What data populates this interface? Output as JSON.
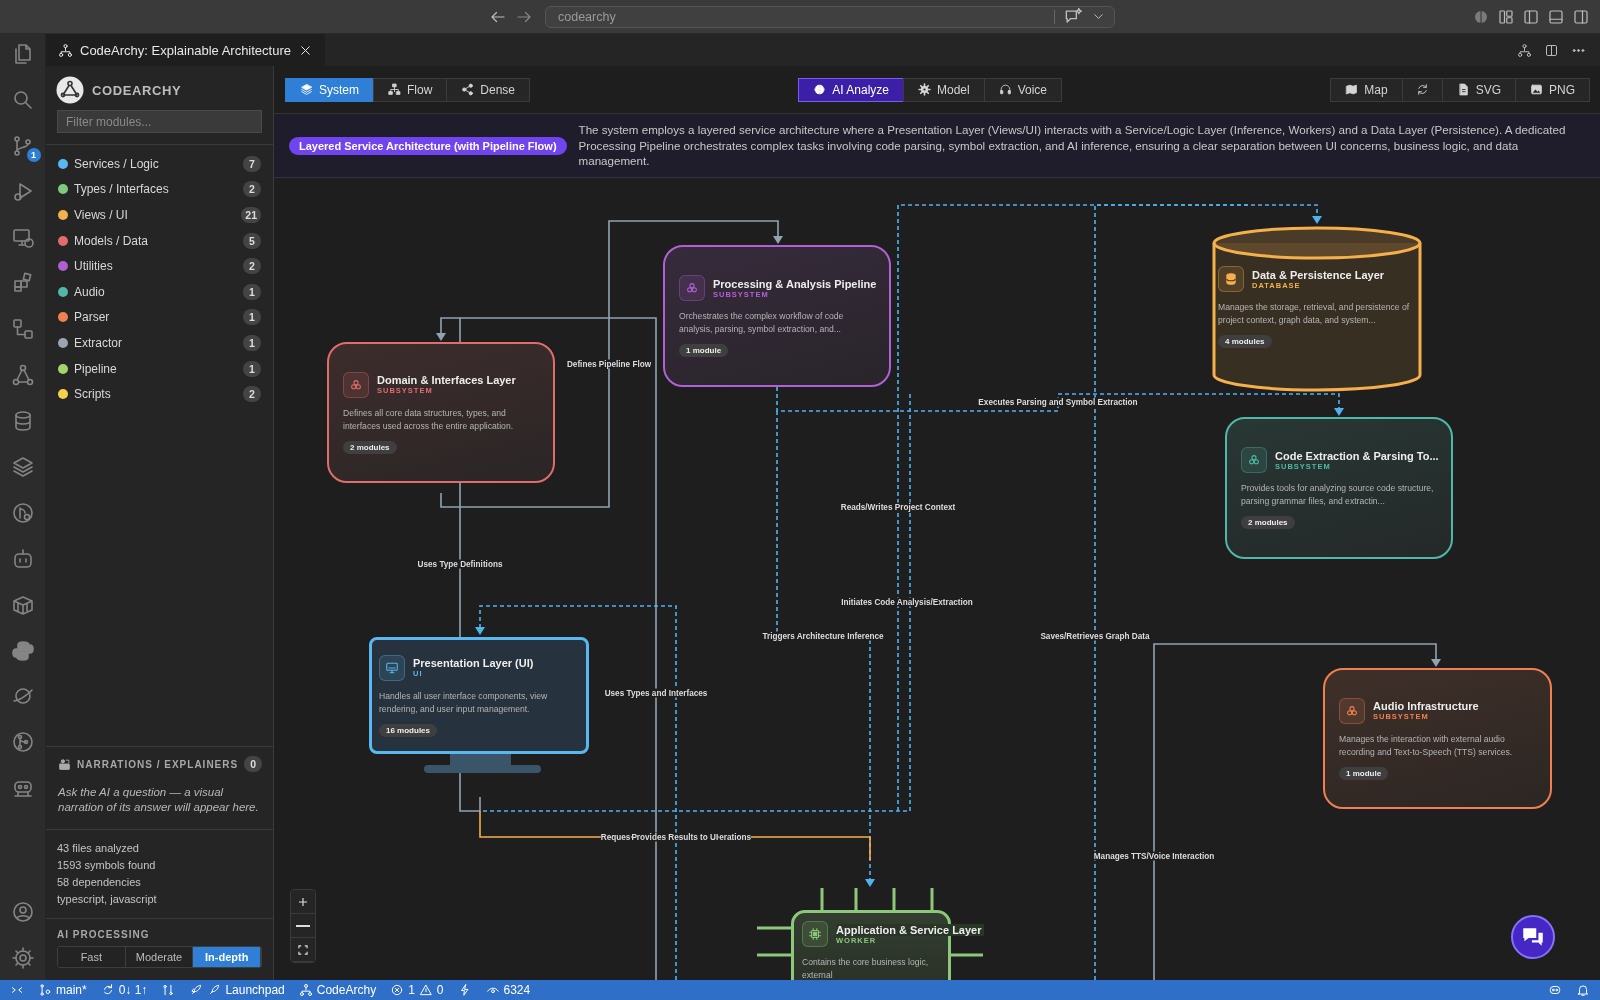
{
  "title_bar": {
    "address": "codearchy"
  },
  "activity_bar": {
    "source_control_badge": "1"
  },
  "editor_tab": {
    "title": "CodeArchy: Explainable Architecture"
  },
  "sidebar": {
    "brand": "CODEARCHY",
    "filter": {
      "placeholder": "Filter modules..."
    },
    "categories": [
      {
        "label": "Services / Logic",
        "count": "7",
        "color": "#5ab8f0"
      },
      {
        "label": "Types / Interfaces",
        "count": "2",
        "color": "#7fc97f"
      },
      {
        "label": "Views / UI",
        "count": "21",
        "color": "#f5b04c"
      },
      {
        "label": "Models / Data",
        "count": "5",
        "color": "#e06c6c"
      },
      {
        "label": "Utilities",
        "count": "2",
        "color": "#b05fd0"
      },
      {
        "label": "Audio",
        "count": "1",
        "color": "#4fb8a6"
      },
      {
        "label": "Parser",
        "count": "1",
        "color": "#f08050"
      },
      {
        "label": "Extractor",
        "count": "1",
        "color": "#9aa5b1"
      },
      {
        "label": "Pipeline",
        "count": "1",
        "color": "#a5d46a"
      },
      {
        "label": "Scripts",
        "count": "2",
        "color": "#f5d04c"
      }
    ],
    "narrations": {
      "title": "NARRATIONS / EXPLAINERS",
      "count": "0",
      "hint": "Ask the AI a question — a visual narration of its answer will appear here."
    },
    "stats": [
      "43 files analyzed",
      "1593 symbols found",
      "58 dependencies",
      "typescript, javascript"
    ],
    "ai_processing": {
      "title": "AI PROCESSING",
      "options": [
        {
          "label": "Fast",
          "selected": false
        },
        {
          "label": "Moderate",
          "selected": false
        },
        {
          "label": "In-depth",
          "selected": true
        }
      ]
    }
  },
  "toolbar": {
    "view_modes": [
      {
        "label": "System",
        "selected": true
      },
      {
        "label": "Flow",
        "selected": false
      },
      {
        "label": "Dense",
        "selected": false
      }
    ],
    "ai_actions": [
      {
        "label": "AI Analyze",
        "kind": "primary"
      },
      {
        "label": "Model",
        "kind": "plain"
      },
      {
        "label": "Voice",
        "kind": "plain"
      }
    ],
    "export_actions": [
      {
        "kind": "text",
        "label": "Map"
      },
      {
        "kind": "icon"
      },
      {
        "kind": "text",
        "label": "SVG"
      },
      {
        "kind": "text",
        "label": "PNG"
      }
    ]
  },
  "summary": {
    "pattern": "Layered Service Architecture (with Pipeline Flow)",
    "description": "The system employs a layered service architecture where a Presentation Layer (Views/UI) interacts with a Service/Logic Layer (Inference, Workers) and a Data Layer (Persistence). A dedicated Processing Pipeline orchestrates complex tasks involving code parsing, symbol extraction, and AI inference, ensuring a clear separation between UI concerns, business logic, and data management."
  },
  "diagram": {
    "nodes": [
      {
        "kind": "subsystem",
        "title": "Processing & Analysis Pipeline",
        "type": "SUBSYSTEM",
        "color": "#b360d6",
        "description": "Orchestrates the complex workflow of code analysis, parsing, symbol extraction, and...",
        "modules": "1 module"
      },
      {
        "kind": "database",
        "title": "Data & Persistence Layer",
        "type": "DATABASE",
        "color": "#f5b04c",
        "description": "Manages the storage, retrieval, and persistence of project context, graph data, and system...",
        "modules": "4 modules"
      },
      {
        "kind": "subsystem",
        "title": "Domain & Interfaces Layer",
        "type": "SUBSYSTEM",
        "color": "#e06c6c",
        "description": "Defines all core data structures, types, and interfaces used across the entire application.",
        "modules": "2 modules"
      },
      {
        "kind": "subsystem",
        "title": "Code Extraction & Parsing To...",
        "type": "SUBSYSTEM",
        "color": "#4fb8a6",
        "description": "Provides tools for analyzing source code structure, parsing grammar files, and extractin...",
        "modules": "2 modules"
      },
      {
        "kind": "ui",
        "title": "Presentation Layer (UI)",
        "type": "UI",
        "color": "#5ab8f0",
        "description": "Handles all user interface components, view rendering, and user input management.",
        "modules": "16 modules"
      },
      {
        "kind": "subsystem",
        "title": "Audio Infrastructure",
        "type": "SUBSYSTEM",
        "color": "#f08050",
        "description": "Manages the interaction with external audio recording and Text-to-Speech (TTS) services.",
        "modules": "1 module"
      },
      {
        "kind": "worker",
        "title": "Application & Service Layer",
        "type": "WORKER",
        "color": "#8dc77a",
        "description": "Contains the core business logic, external"
      }
    ],
    "edges": [
      {
        "label": "Defines Pipeline Flow",
        "color": "#8fa3b3",
        "dashed": false
      },
      {
        "label": "Uses Type Definitions",
        "color": "#8fa3b3",
        "dashed": false
      },
      {
        "label": "Uses Types and Interfaces",
        "color": "#8fa3b3",
        "dashed": false
      },
      {
        "label": "Executes Parsing and Symbol Extraction",
        "color": "#4fb3f0",
        "dashed": true
      },
      {
        "label": "Reads/Writes Project Context",
        "color": "#4fb3f0",
        "dashed": true
      },
      {
        "label": "Initiates Code Analysis/Extraction",
        "color": "#4fb3f0",
        "dashed": true
      },
      {
        "label": "Triggers Architecture Inference",
        "color": "#4fb3f0",
        "dashed": true
      },
      {
        "label": "Provides Results to UI",
        "color": "#4fb3f0",
        "dashed": true
      },
      {
        "label_parts": [
          "Reques",
          "erations"
        ],
        "color": "#f5b04c",
        "dashed": false
      },
      {
        "label": "Saves/Retrieves Graph Data",
        "color": "#4fb3f0",
        "dashed": true
      },
      {
        "label": "Manages TTS/Voice Interaction",
        "color": "#8fa3b3",
        "dashed": false
      }
    ]
  },
  "status_bar": {
    "branch": "main*",
    "sync": "0↓ 1↑",
    "launchpad": "Launchpad",
    "extension": "CodeArchy",
    "errors": "1",
    "warnings": "0",
    "port": "6324"
  }
}
